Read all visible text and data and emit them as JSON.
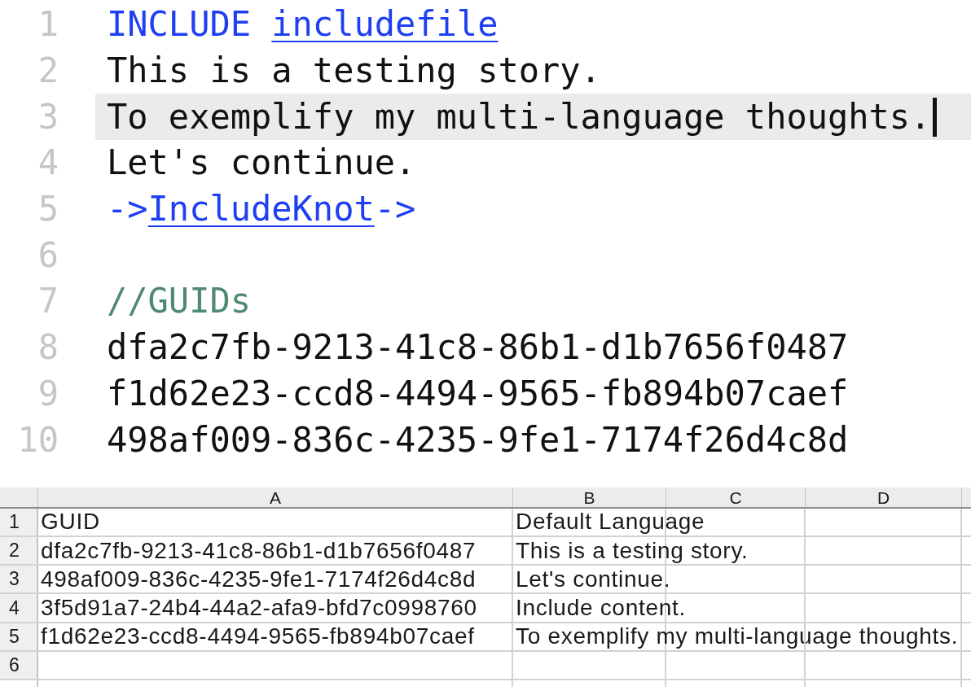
{
  "editor": {
    "lines": [
      {
        "number": "1",
        "current": false,
        "tokens": [
          {
            "kind": "keyword",
            "text": "INCLUDE "
          },
          {
            "kind": "link",
            "text": "includefile"
          }
        ]
      },
      {
        "number": "2",
        "current": false,
        "tokens": [
          {
            "kind": "text",
            "text": "This is a testing story."
          }
        ]
      },
      {
        "number": "3",
        "current": true,
        "tokens": [
          {
            "kind": "text",
            "text": "To exemplify my multi-language thoughts."
          }
        ]
      },
      {
        "number": "4",
        "current": false,
        "tokens": [
          {
            "kind": "text",
            "text": "Let's continue."
          }
        ]
      },
      {
        "number": "5",
        "current": false,
        "tokens": [
          {
            "kind": "keyword",
            "text": "->"
          },
          {
            "kind": "link",
            "text": "IncludeKnot"
          },
          {
            "kind": "keyword",
            "text": "->"
          }
        ]
      },
      {
        "number": "6",
        "current": false
      },
      {
        "number": "7",
        "current": false,
        "tokens": [
          {
            "kind": "comment",
            "text": "//GUIDs"
          }
        ]
      },
      {
        "number": "8",
        "current": false,
        "tokens": [
          {
            "kind": "text",
            "text": "dfa2c7fb-9213-41c8-86b1-d1b7656f0487"
          }
        ]
      },
      {
        "number": "9",
        "current": false,
        "tokens": [
          {
            "kind": "text",
            "text": "f1d62e23-ccd8-4494-9565-fb894b07caef"
          }
        ]
      },
      {
        "number": "10",
        "current": false,
        "tokens": [
          {
            "kind": "text",
            "text": "498af009-836c-4235-9fe1-7174f26d4c8d"
          }
        ]
      }
    ]
  },
  "spreadsheet": {
    "columns": [
      "A",
      "B",
      "C",
      "D"
    ],
    "rows": [
      {
        "number": "1",
        "cells": [
          "GUID",
          "Default Language"
        ]
      },
      {
        "number": "2",
        "cells": [
          "dfa2c7fb-9213-41c8-86b1-d1b7656f0487",
          "This is a testing story."
        ]
      },
      {
        "number": "3",
        "cells": [
          "498af009-836c-4235-9fe1-7174f26d4c8d",
          "Let's continue."
        ]
      },
      {
        "number": "4",
        "cells": [
          "3f5d91a7-24b4-44a2-afa9-bfd7c0998760",
          "Include content."
        ]
      },
      {
        "number": "5",
        "cells": [
          "f1d62e23-ccd8-4494-9565-fb894b07caef",
          "To exemplify my multi-language thoughts."
        ]
      },
      {
        "number": "6"
      }
    ]
  }
}
